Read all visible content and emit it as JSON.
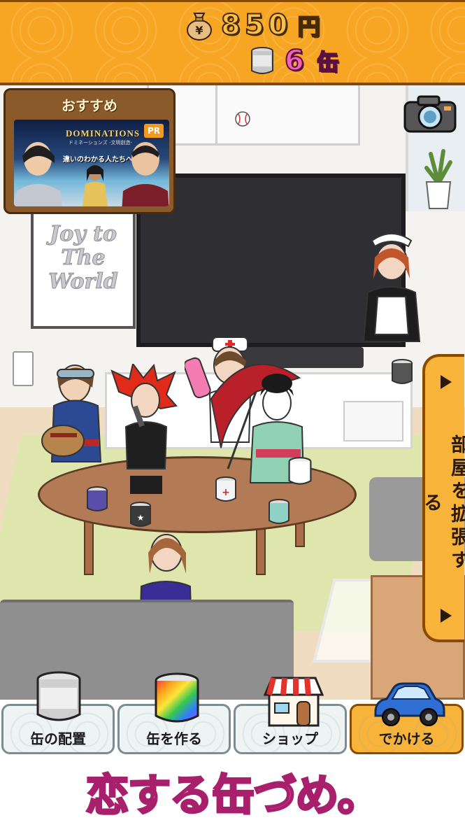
{
  "status": {
    "money_value": "850",
    "money_unit": "円",
    "money_icon": "money-bag-yen-icon",
    "cans_value": "6",
    "cans_unit": "缶",
    "cans_icon": "tin-can-icon"
  },
  "recommend": {
    "title": "おすすめ",
    "badge": "PR",
    "game_logo": "DOMINATIONS",
    "game_subtitle": "ドミネーションズ -文明創造-",
    "tagline": "違いのわかる人たちへ。"
  },
  "scene": {
    "poster_text": [
      "Joy to",
      "The",
      "World"
    ],
    "camera_icon": "camera-icon"
  },
  "expand_room": {
    "label": "部屋を拡張する"
  },
  "toolbar": {
    "items": [
      {
        "label": "缶の配置",
        "icon": "silver-can-icon"
      },
      {
        "label": "缶を作る",
        "icon": "rainbow-can-icon"
      },
      {
        "label": "ショップ",
        "icon": "shop-icon"
      },
      {
        "label": "でかける",
        "icon": "blue-car-icon"
      }
    ],
    "active_index": 3
  },
  "footer": {
    "logo": "恋する缶づめ。"
  },
  "colors": {
    "topbar": "#f6a623",
    "accent_pink": "#f46bbd",
    "button_orange": "#f7b33a"
  }
}
